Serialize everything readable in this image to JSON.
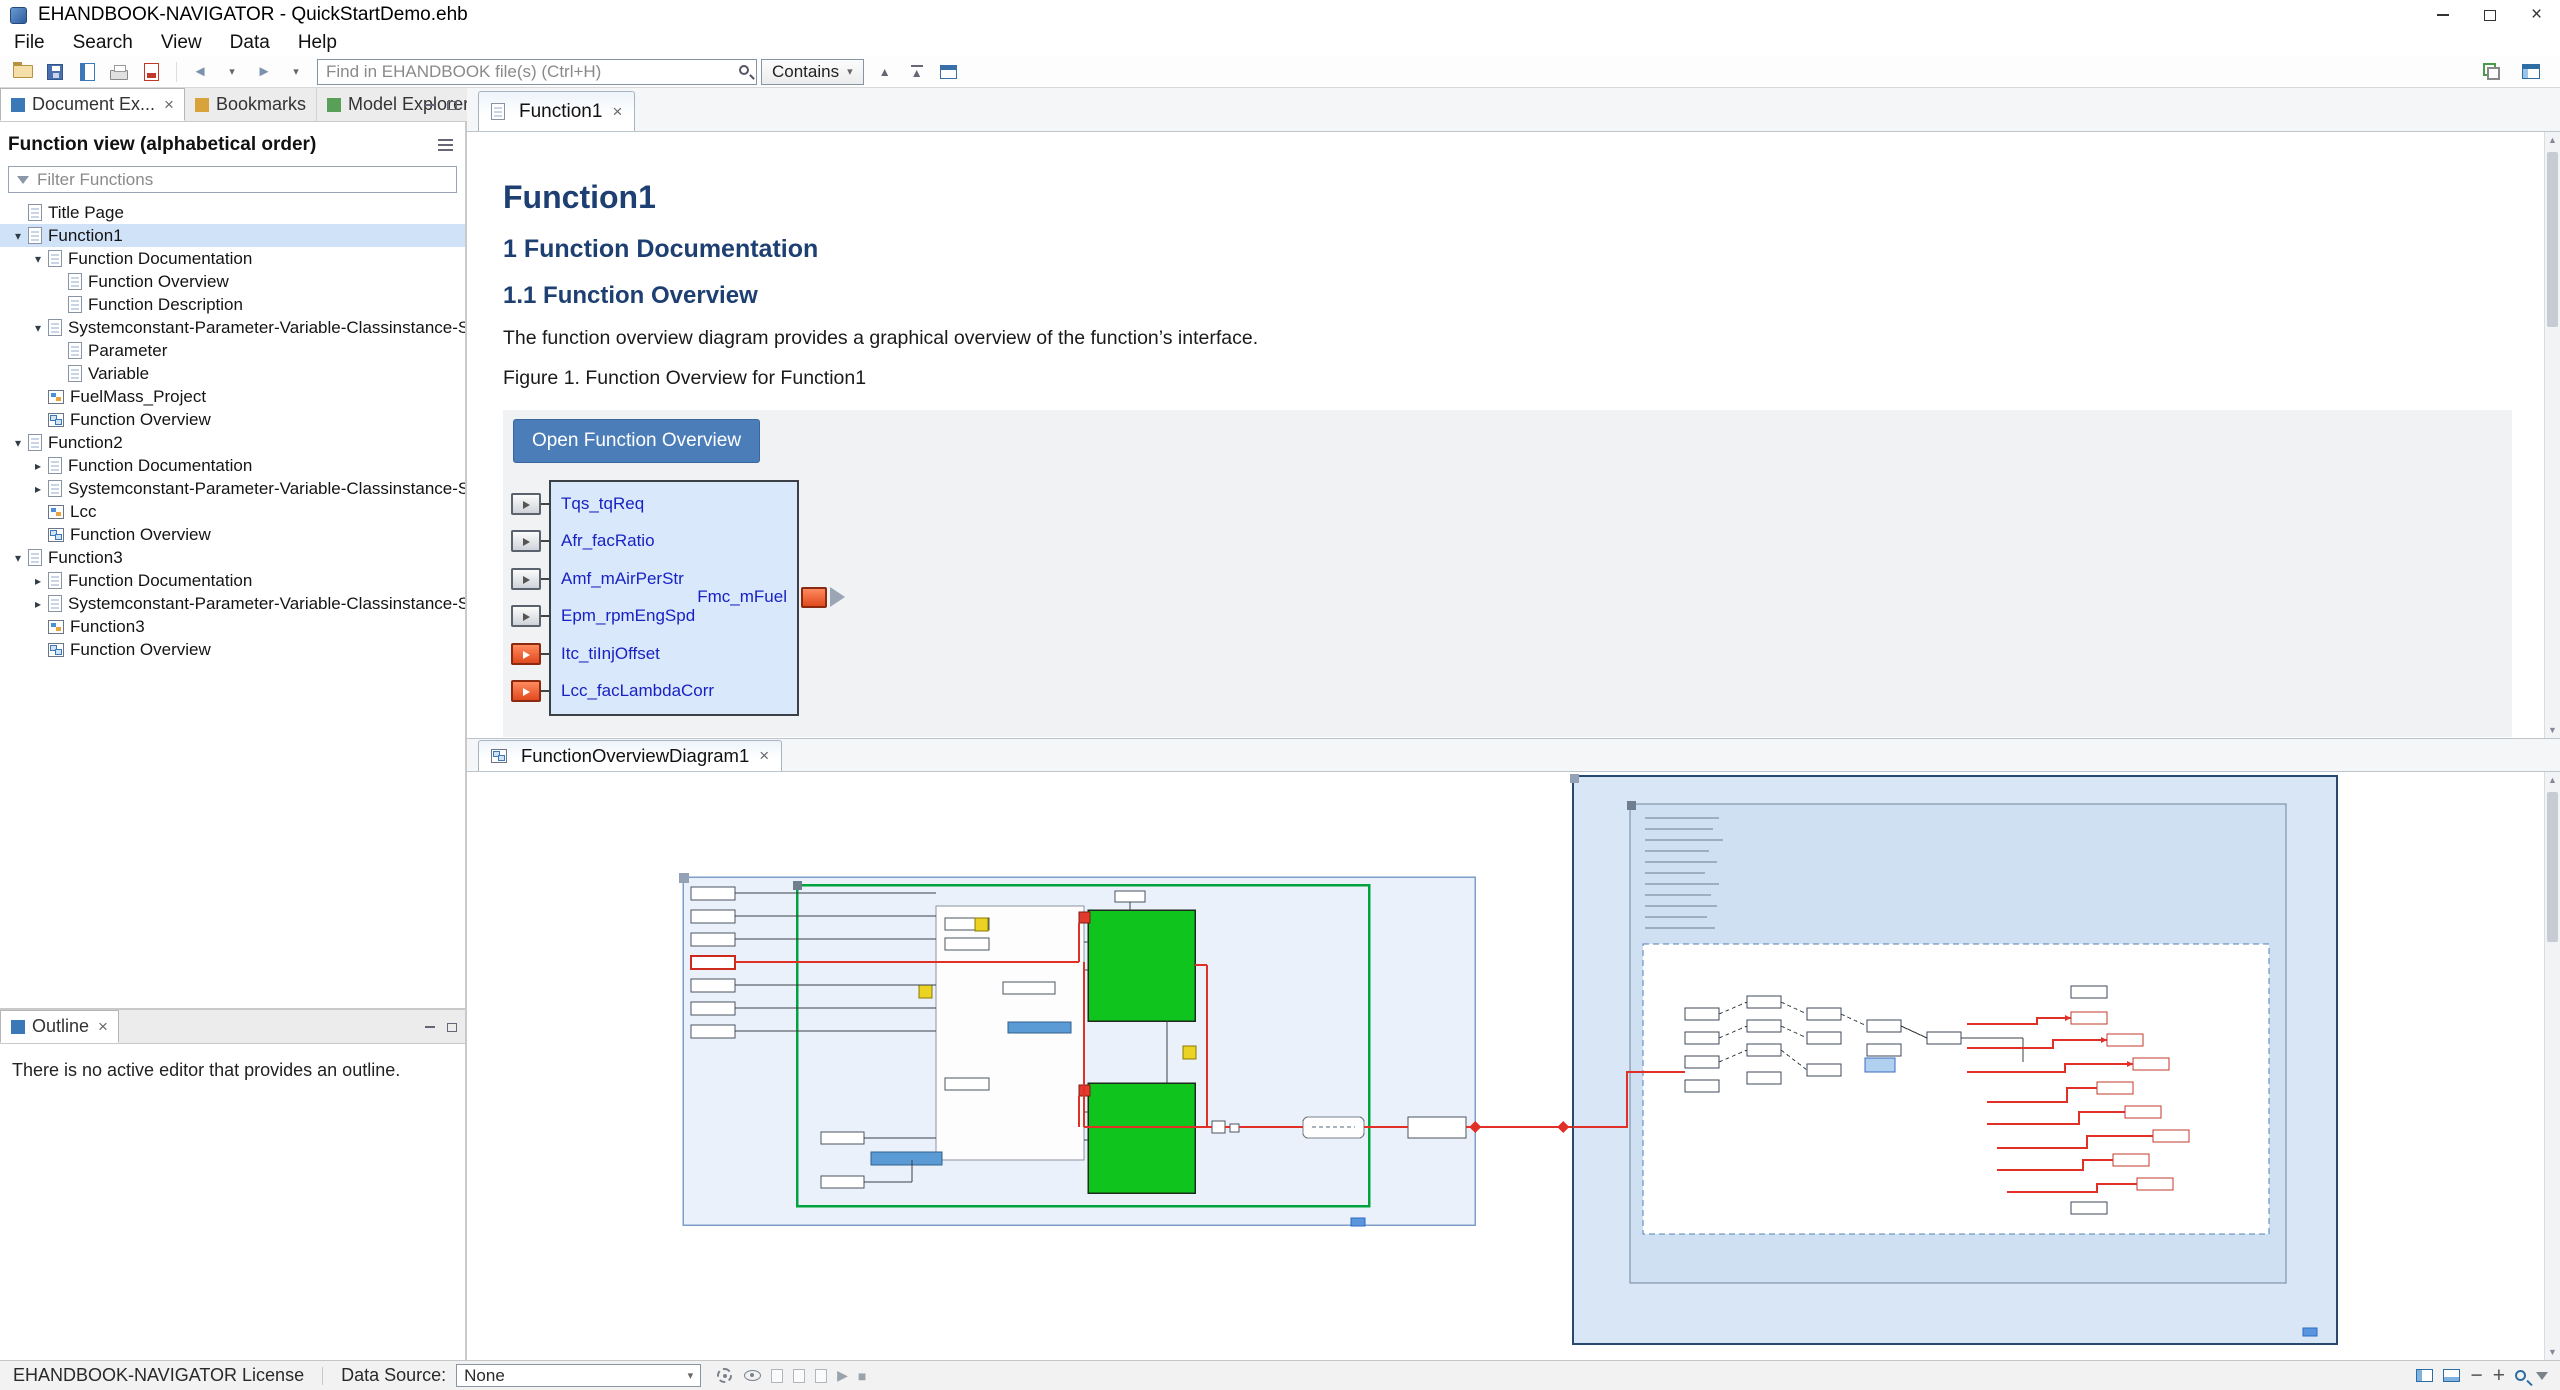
{
  "window": {
    "title": "EHANDBOOK-NAVIGATOR - QuickStartDemo.ehb"
  },
  "menu": {
    "items": [
      "File",
      "Search",
      "View",
      "Data",
      "Help"
    ]
  },
  "toolbar": {
    "search_placeholder": "Find in EHANDBOOK file(s) (Ctrl+H)",
    "contains_label": "Contains"
  },
  "left": {
    "tabs": [
      "Document Ex...",
      "Bookmarks",
      "Model Explorer"
    ],
    "view_title": "Function view (alphabetical order)",
    "filter_placeholder": "Filter Functions",
    "tree": [
      {
        "label": "Title Page",
        "indent": 0,
        "state": "leaf"
      },
      {
        "label": "Function1",
        "indent": 0,
        "state": "expanded",
        "selected": true
      },
      {
        "label": "Function Documentation",
        "indent": 1,
        "state": "expanded"
      },
      {
        "label": "Function Overview",
        "indent": 2,
        "state": "leaf"
      },
      {
        "label": "Function Description",
        "indent": 2,
        "state": "leaf"
      },
      {
        "label": "Systemconstant-Parameter-Variable-Classinstance-Structure",
        "indent": 1,
        "state": "expanded"
      },
      {
        "label": "Parameter",
        "indent": 2,
        "state": "leaf"
      },
      {
        "label": "Variable",
        "indent": 2,
        "state": "leaf"
      },
      {
        "label": "FuelMass_Project",
        "indent": 1,
        "state": "leaf"
      },
      {
        "label": "Function Overview",
        "indent": 1,
        "state": "leaf"
      },
      {
        "label": "Function2",
        "indent": 0,
        "state": "expanded"
      },
      {
        "label": "Function Documentation",
        "indent": 1,
        "state": "collapsed"
      },
      {
        "label": "Systemconstant-Parameter-Variable-Classinstance-Structure",
        "indent": 1,
        "state": "collapsed"
      },
      {
        "label": "Lcc",
        "indent": 1,
        "state": "leaf"
      },
      {
        "label": "Function Overview",
        "indent": 1,
        "state": "leaf"
      },
      {
        "label": "Function3",
        "indent": 0,
        "state": "expanded"
      },
      {
        "label": "Function Documentation",
        "indent": 1,
        "state": "collapsed"
      },
      {
        "label": "Systemconstant-Parameter-Variable-Classinstance-Structure",
        "indent": 1,
        "state": "collapsed"
      },
      {
        "label": "Function3",
        "indent": 1,
        "state": "leaf"
      },
      {
        "label": "Function Overview",
        "indent": 1,
        "state": "leaf"
      }
    ]
  },
  "outline": {
    "title": "Outline",
    "message": "There is no active editor that provides an outline."
  },
  "editor": {
    "tab_label": "Function1",
    "title": "Function1",
    "section_heading": "1 Function Documentation",
    "subsection_heading": "1.1 Function Overview",
    "paragraph": "The function overview diagram provides a graphical overview of the function’s interface.",
    "figure_caption": "Figure 1. Function Overview for Function1",
    "open_button_label": "Open Function Overview",
    "block": {
      "inputs": [
        "Tqs_tqReq",
        "Afr_facRatio",
        "Amf_mAirPerStr",
        "Epm_rpmEngSpd",
        "Itc_tiInjOffset",
        "Lcc_facLambdaCorr"
      ],
      "output": "Fmc_mFuel"
    }
  },
  "bottom": {
    "tab_label": "FunctionOverviewDiagram1"
  },
  "status": {
    "license": "EHANDBOOK-NAVIGATOR License",
    "data_source_label": "Data Source:",
    "data_source_value": "None"
  },
  "colors": {
    "accent_button": "#4b7db8",
    "heading": "#1d3f72",
    "block_fill": "#d9e8fa",
    "diagram_green": "#0fc41c",
    "port_red": "#e04a1e",
    "tree_selection": "#cfe2f7"
  }
}
